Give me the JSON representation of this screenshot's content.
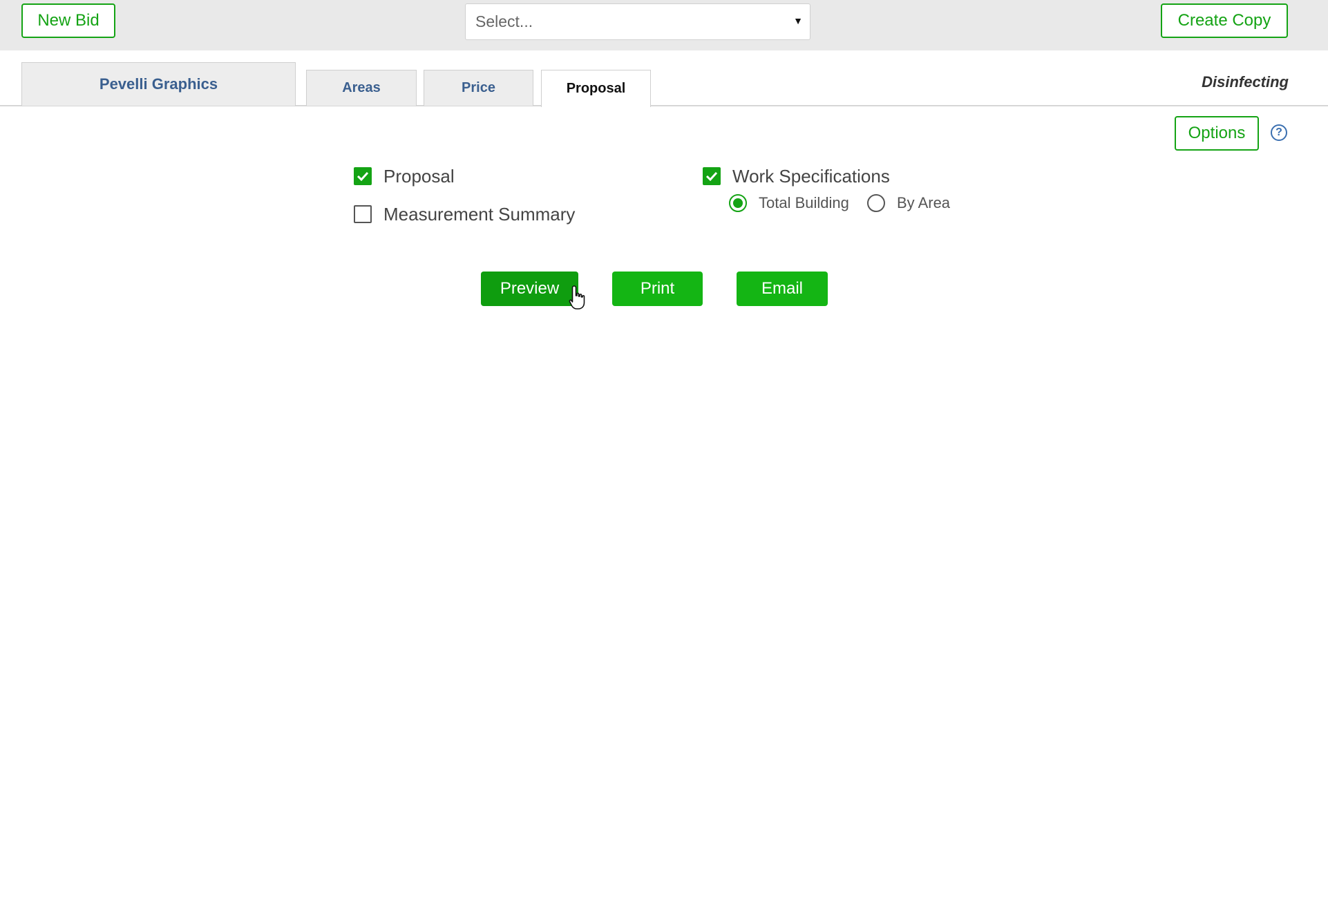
{
  "toolbar": {
    "new_bid_label": "New Bid",
    "select_placeholder": "Select...",
    "create_copy_label": "Create Copy"
  },
  "tabs": [
    {
      "label": "Pevelli Graphics"
    },
    {
      "label": "Areas"
    },
    {
      "label": "Price"
    },
    {
      "label": "Proposal",
      "active": true
    }
  ],
  "service_label": "Disinfecting",
  "options": {
    "label": "Options",
    "help_glyph": "?"
  },
  "checkboxes": {
    "proposal": {
      "label": "Proposal",
      "checked": true
    },
    "measurement_summary": {
      "label": "Measurement Summary",
      "checked": false
    },
    "work_specifications": {
      "label": "Work Specifications",
      "checked": true
    }
  },
  "work_spec_scope": {
    "options": [
      {
        "label": "Total Building",
        "selected": true
      },
      {
        "label": "By Area",
        "selected": false
      }
    ]
  },
  "actions": {
    "preview_label": "Preview",
    "print_label": "Print",
    "email_label": "Email"
  },
  "colors": {
    "accent_green": "#14a314",
    "toolbar_bg": "#e9e9e9",
    "tab_text": "#3a5f8f"
  }
}
